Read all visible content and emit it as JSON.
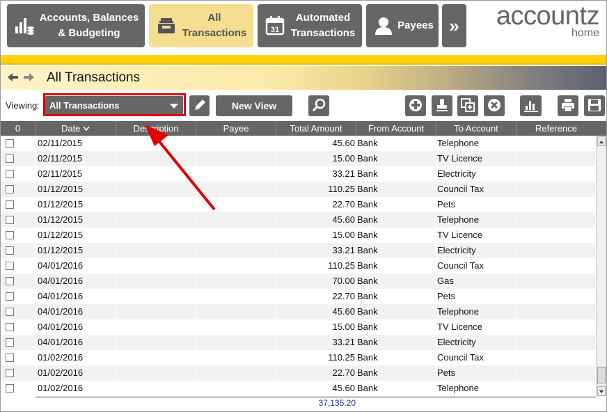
{
  "nav": {
    "items": [
      {
        "label": "Accounts, Balances\n& Budgeting",
        "icon": "bar-coins-icon"
      },
      {
        "label": "All\nTransactions",
        "icon": "inbox-tray-icon"
      },
      {
        "label": "Automated\nTransactions",
        "icon": "calendar-icon"
      },
      {
        "label": "Payees",
        "icon": "person-icon"
      },
      {
        "label": "»",
        "icon": "double-chevron-right-icon"
      }
    ],
    "brand": "accountz",
    "brand_sub": "home"
  },
  "page": {
    "title": "All Transactions"
  },
  "toolbar": {
    "viewing_label": "Viewing:",
    "view_selected": "All Transactions",
    "new_view_label": "New View",
    "icons": [
      "edit-pencil-icon",
      "search-icon",
      "add-icon",
      "stamp-icon",
      "duplicate-icon",
      "delete-icon",
      "chart-icon",
      "print-icon",
      "save-icon"
    ]
  },
  "colors": {
    "accent_yellow": "#ffd400",
    "button_gray": "#666666",
    "highlight_red": "#e00000",
    "total_blue": "#1a2ea0"
  },
  "table": {
    "columns": [
      "0",
      "Date",
      "Description",
      "Payee",
      "Total Amount",
      "From Account",
      "To Account",
      "Reference"
    ],
    "sort_indicator": "chevron-down-icon",
    "rows": [
      {
        "date": "02/11/2015",
        "description": "",
        "payee": "",
        "amount": "45.60",
        "from": "Bank",
        "to": "Telephone",
        "reference": ""
      },
      {
        "date": "02/11/2015",
        "description": "",
        "payee": "",
        "amount": "15.00",
        "from": "Bank",
        "to": "TV Licence",
        "reference": ""
      },
      {
        "date": "02/11/2015",
        "description": "",
        "payee": "",
        "amount": "33.21",
        "from": "Bank",
        "to": "Electricity",
        "reference": ""
      },
      {
        "date": "01/12/2015",
        "description": "",
        "payee": "",
        "amount": "110.25",
        "from": "Bank",
        "to": "Council Tax",
        "reference": ""
      },
      {
        "date": "01/12/2015",
        "description": "",
        "payee": "",
        "amount": "22.70",
        "from": "Bank",
        "to": "Pets",
        "reference": ""
      },
      {
        "date": "01/12/2015",
        "description": "",
        "payee": "",
        "amount": "45.60",
        "from": "Bank",
        "to": "Telephone",
        "reference": ""
      },
      {
        "date": "01/12/2015",
        "description": "",
        "payee": "",
        "amount": "15.00",
        "from": "Bank",
        "to": "TV Licence",
        "reference": ""
      },
      {
        "date": "01/12/2015",
        "description": "",
        "payee": "",
        "amount": "33.21",
        "from": "Bank",
        "to": "Electricity",
        "reference": ""
      },
      {
        "date": "04/01/2016",
        "description": "",
        "payee": "",
        "amount": "110.25",
        "from": "Bank",
        "to": "Council Tax",
        "reference": ""
      },
      {
        "date": "04/01/2016",
        "description": "",
        "payee": "",
        "amount": "70.00",
        "from": "Bank",
        "to": "Gas",
        "reference": ""
      },
      {
        "date": "04/01/2016",
        "description": "",
        "payee": "",
        "amount": "22.70",
        "from": "Bank",
        "to": "Pets",
        "reference": ""
      },
      {
        "date": "04/01/2016",
        "description": "",
        "payee": "",
        "amount": "45.60",
        "from": "Bank",
        "to": "Telephone",
        "reference": ""
      },
      {
        "date": "04/01/2016",
        "description": "",
        "payee": "",
        "amount": "15.00",
        "from": "Bank",
        "to": "TV Licence",
        "reference": ""
      },
      {
        "date": "04/01/2016",
        "description": "",
        "payee": "",
        "amount": "33.21",
        "from": "Bank",
        "to": "Electricity",
        "reference": ""
      },
      {
        "date": "01/02/2016",
        "description": "",
        "payee": "",
        "amount": "110.25",
        "from": "Bank",
        "to": "Council Tax",
        "reference": ""
      },
      {
        "date": "01/02/2016",
        "description": "",
        "payee": "",
        "amount": "22.70",
        "from": "Bank",
        "to": "Pets",
        "reference": ""
      },
      {
        "date": "01/02/2016",
        "description": "",
        "payee": "",
        "amount": "45.60",
        "from": "Bank",
        "to": "Telephone",
        "reference": ""
      }
    ],
    "total": "37,135.20"
  }
}
